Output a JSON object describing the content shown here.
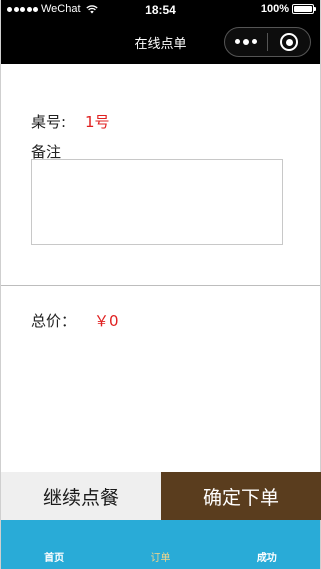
{
  "status_bar": {
    "carrier": "WeChat",
    "time": "18:54",
    "battery": "100%"
  },
  "nav": {
    "title": "在线点单"
  },
  "order": {
    "table_label": "桌号:",
    "table_value": "1号",
    "remark_label": "备注",
    "remark_value": "",
    "total_label": "总价：",
    "total_value": "￥0"
  },
  "actions": {
    "continue_label": "继续点餐",
    "submit_label": "确定下单"
  },
  "tabbar": {
    "items": [
      {
        "label": "首页"
      },
      {
        "label": "订单"
      },
      {
        "label": "成功"
      }
    ],
    "active_index": 1
  },
  "colors": {
    "accent_red": "#e02020",
    "submit_bg": "#5a3d1e",
    "tabbar_bg": "#29abd7",
    "tab_active": "#f2d58a"
  }
}
